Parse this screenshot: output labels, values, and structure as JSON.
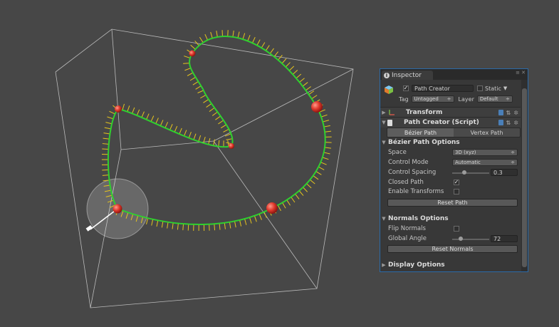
{
  "inspector": {
    "tab_label": "Inspector",
    "object_name": "Path Creator",
    "static_label": "Static",
    "tag_label": "Tag",
    "tag_value": "Untagged",
    "layer_label": "Layer",
    "layer_value": "Default",
    "components": {
      "transform": "Transform",
      "path_creator": "Path Creator (Script)"
    },
    "path_tabs": [
      "Bézier Path",
      "Vertex Path"
    ],
    "bezier_section": {
      "title": "Bézier Path Options",
      "space_label": "Space",
      "space_value": "3D (xyz)",
      "control_mode_label": "Control Mode",
      "control_mode_value": "Automatic",
      "control_spacing_label": "Control Spacing",
      "control_spacing_value": "0.3",
      "control_spacing_fraction": 0.3,
      "closed_path_label": "Closed Path",
      "closed_path_checked": true,
      "enable_transforms_label": "Enable Transforms",
      "enable_transforms_checked": false,
      "reset_path_label": "Reset Path"
    },
    "normals_section": {
      "title": "Normals Options",
      "flip_normals_label": "Flip Normals",
      "flip_normals_checked": false,
      "global_angle_label": "Global Angle",
      "global_angle_value": "72",
      "global_angle_fraction": 0.2,
      "reset_normals_label": "Reset Normals"
    },
    "display_section": {
      "title": "Display Options"
    },
    "checkmark_glyph": "✓"
  },
  "colors": {
    "path": "#2fd02f",
    "normals": "#e6c41e",
    "anchors": "#e53b2d",
    "accent_border": "#2b6aa8"
  }
}
